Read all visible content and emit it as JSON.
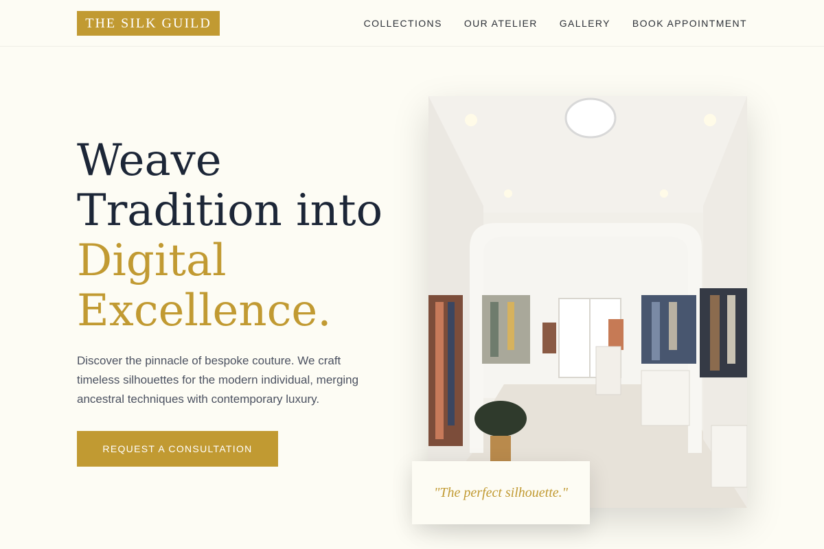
{
  "brand": {
    "name": "THE SILK GUILD",
    "accent_color": "#c19a32",
    "heading_color": "#1c2637"
  },
  "nav": {
    "items": [
      {
        "label": "COLLECTIONS"
      },
      {
        "label": "OUR ATELIER"
      },
      {
        "label": "GALLERY"
      },
      {
        "label": "BOOK APPOINTMENT"
      }
    ]
  },
  "hero": {
    "headline_line1": "Weave",
    "headline_line2": "Tradition into",
    "headline_accent_line1": "Digital",
    "headline_accent_line2": "Excellence.",
    "description": "Discover the pinnacle of bespoke couture. We craft timeless silhouettes for the modern individual, merging ancestral techniques with contemporary luxury.",
    "cta_label": "REQUEST A CONSULTATION",
    "image_alt": "boutique-interior-image"
  },
  "quote": {
    "text": "\"The perfect silhouette.\""
  }
}
